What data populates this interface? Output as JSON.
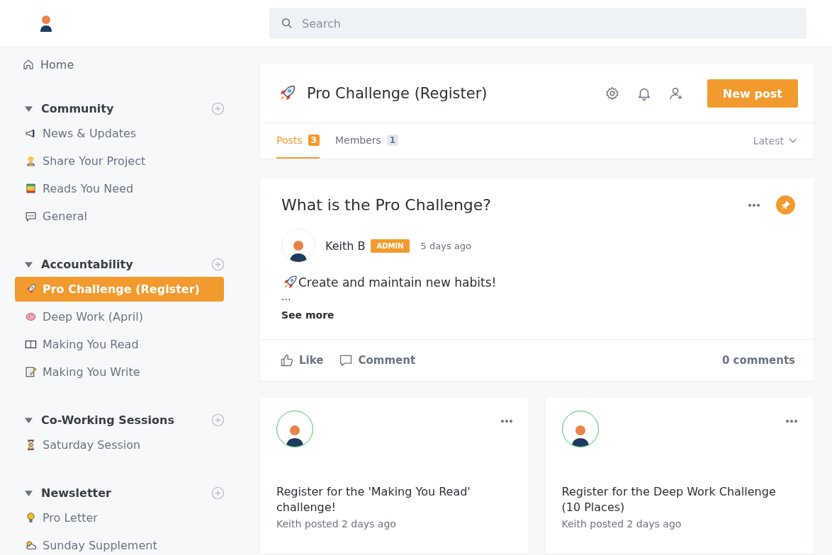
{
  "header": {
    "search": {
      "placeholder": "Search"
    }
  },
  "sidebar": {
    "home": {
      "label": "Home"
    },
    "sections": [
      {
        "title": "Community",
        "expanded": true,
        "items": [
          {
            "label": "News & Updates",
            "selected": false
          },
          {
            "label": "Share Your Project",
            "selected": false
          },
          {
            "label": "Reads You Need",
            "selected": false
          },
          {
            "label": "General",
            "selected": false
          }
        ]
      },
      {
        "title": "Accountability",
        "expanded": true,
        "items": [
          {
            "label": "Pro Challenge (Register)",
            "selected": true
          },
          {
            "label": "Deep Work (April)",
            "selected": false
          },
          {
            "label": "Making You Read",
            "selected": false
          },
          {
            "label": "Making You Write",
            "selected": false
          }
        ]
      },
      {
        "title": "Co-Working Sessions",
        "expanded": true,
        "items": [
          {
            "label": "Saturday Session",
            "selected": false
          }
        ]
      },
      {
        "title": "Newsletter",
        "expanded": true,
        "items": [
          {
            "label": "Pro Letter",
            "selected": false
          },
          {
            "label": "Sunday Supplement",
            "selected": false
          }
        ]
      }
    ]
  },
  "space": {
    "title": "Pro Challenge (Register)",
    "new_post": "New post",
    "tabs": [
      {
        "label": "Posts",
        "count": "3",
        "selected": true
      },
      {
        "label": "Members",
        "count": "1",
        "selected": false
      }
    ],
    "sort": "Latest"
  },
  "pinned_post": {
    "title": "What is the Pro Challenge?",
    "pinned": true,
    "author": "Keith B",
    "role": "ADMIN",
    "time": "5 days ago",
    "body": "Create and maintain new habits!",
    "ellipsis": "...",
    "see_more": "See more",
    "like": "Like",
    "comment": "Comment",
    "comments_count": "0 comments"
  },
  "posts": [
    {
      "title": "Register for the 'Making You Read' challenge!",
      "meta": "Keith posted 2 days ago"
    },
    {
      "title": "Register for the Deep Work Challenge (10 Places)",
      "meta": "Keith posted 2 days ago"
    }
  ]
}
